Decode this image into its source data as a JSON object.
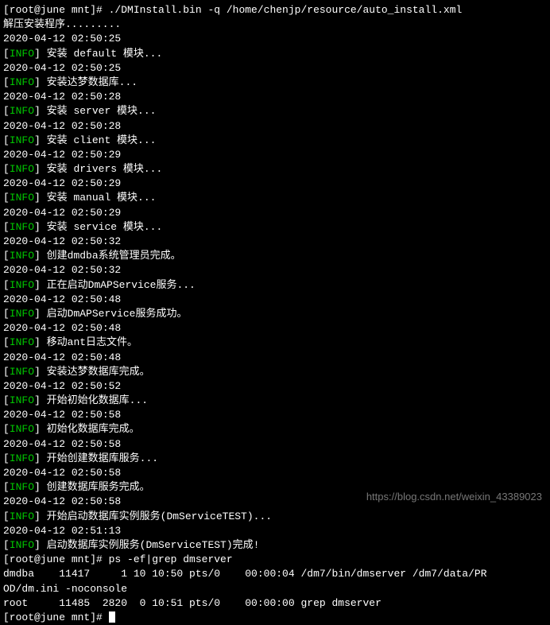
{
  "lines": [
    {
      "type": "prompt",
      "text": "[root@june mnt]# ./DMInstall.bin -q /home/chenjp/resource/auto_install.xml"
    },
    {
      "type": "plain",
      "text": "解压安装程序........."
    },
    {
      "type": "plain",
      "text": "2020-04-12 02:50:25"
    },
    {
      "type": "info",
      "text": "安装 default 模块..."
    },
    {
      "type": "plain",
      "text": "2020-04-12 02:50:25"
    },
    {
      "type": "info",
      "text": "安装达梦数据库..."
    },
    {
      "type": "plain",
      "text": "2020-04-12 02:50:28"
    },
    {
      "type": "info",
      "text": "安装 server 模块..."
    },
    {
      "type": "plain",
      "text": "2020-04-12 02:50:28"
    },
    {
      "type": "info",
      "text": "安装 client 模块..."
    },
    {
      "type": "plain",
      "text": "2020-04-12 02:50:29"
    },
    {
      "type": "info",
      "text": "安装 drivers 模块..."
    },
    {
      "type": "plain",
      "text": "2020-04-12 02:50:29"
    },
    {
      "type": "info",
      "text": "安装 manual 模块..."
    },
    {
      "type": "plain",
      "text": "2020-04-12 02:50:29"
    },
    {
      "type": "info",
      "text": "安装 service 模块..."
    },
    {
      "type": "plain",
      "text": "2020-04-12 02:50:32"
    },
    {
      "type": "info",
      "text": "创建dmdba系统管理员完成。"
    },
    {
      "type": "plain",
      "text": "2020-04-12 02:50:32"
    },
    {
      "type": "info",
      "text": "正在启动DmAPService服务..."
    },
    {
      "type": "plain",
      "text": "2020-04-12 02:50:48"
    },
    {
      "type": "info",
      "text": "启动DmAPService服务成功。"
    },
    {
      "type": "plain",
      "text": "2020-04-12 02:50:48"
    },
    {
      "type": "info",
      "text": "移动ant日志文件。"
    },
    {
      "type": "plain",
      "text": "2020-04-12 02:50:48"
    },
    {
      "type": "info",
      "text": "安装达梦数据库完成。"
    },
    {
      "type": "plain",
      "text": "2020-04-12 02:50:52"
    },
    {
      "type": "info",
      "text": "开始初始化数据库..."
    },
    {
      "type": "plain",
      "text": "2020-04-12 02:50:58"
    },
    {
      "type": "info",
      "text": "初始化数据库完成。"
    },
    {
      "type": "plain",
      "text": "2020-04-12 02:50:58"
    },
    {
      "type": "info",
      "text": "开始创建数据库服务..."
    },
    {
      "type": "plain",
      "text": "2020-04-12 02:50:58"
    },
    {
      "type": "info",
      "text": "创建数据库服务完成。"
    },
    {
      "type": "plain",
      "text": "2020-04-12 02:50:58"
    },
    {
      "type": "info",
      "text": "开始启动数据库实例服务(DmServiceTEST)..."
    },
    {
      "type": "plain",
      "text": "2020-04-12 02:51:13"
    },
    {
      "type": "info",
      "text": "启动数据库实例服务(DmServiceTEST)完成!"
    },
    {
      "type": "prompt",
      "text": "[root@june mnt]# ps -ef|grep dmserver"
    },
    {
      "type": "plain",
      "text": "dmdba    11417     1 10 10:50 pts/0    00:00:04 /dm7/bin/dmserver /dm7/data/PR"
    },
    {
      "type": "plain",
      "text": "OD/dm.ini -noconsole"
    },
    {
      "type": "plain",
      "text": "root     11485  2820  0 10:51 pts/0    00:00:00 grep dmserver"
    },
    {
      "type": "prompt-cursor",
      "text": "[root@june mnt]# "
    }
  ],
  "info_label": "INFO",
  "watermark": "https://blog.csdn.net/weixin_43389023"
}
